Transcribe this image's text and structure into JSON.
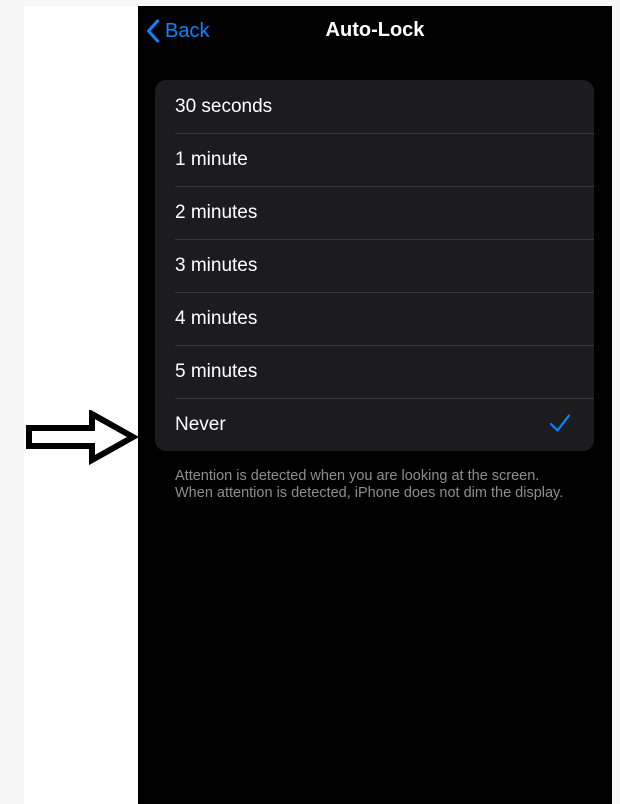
{
  "nav": {
    "back_label": "Back",
    "title": "Auto-Lock"
  },
  "options": [
    {
      "label": "30 seconds",
      "selected": false
    },
    {
      "label": "1 minute",
      "selected": false
    },
    {
      "label": "2 minutes",
      "selected": false
    },
    {
      "label": "3 minutes",
      "selected": false
    },
    {
      "label": "4 minutes",
      "selected": false
    },
    {
      "label": "5 minutes",
      "selected": false
    },
    {
      "label": "Never",
      "selected": true
    }
  ],
  "footer_note": "Attention is detected when you are looking at the screen. When attention is detected, iPhone does not dim the display.",
  "icons": {
    "back": "chevron-left-icon",
    "selected": "checkmark-icon",
    "annotation": "right-arrow-icon"
  },
  "colors": {
    "accent": "#0a84ff",
    "background": "#000000",
    "group_background": "#1c1c1e",
    "separator": "#38383a",
    "secondary_text": "#8d8d93"
  }
}
